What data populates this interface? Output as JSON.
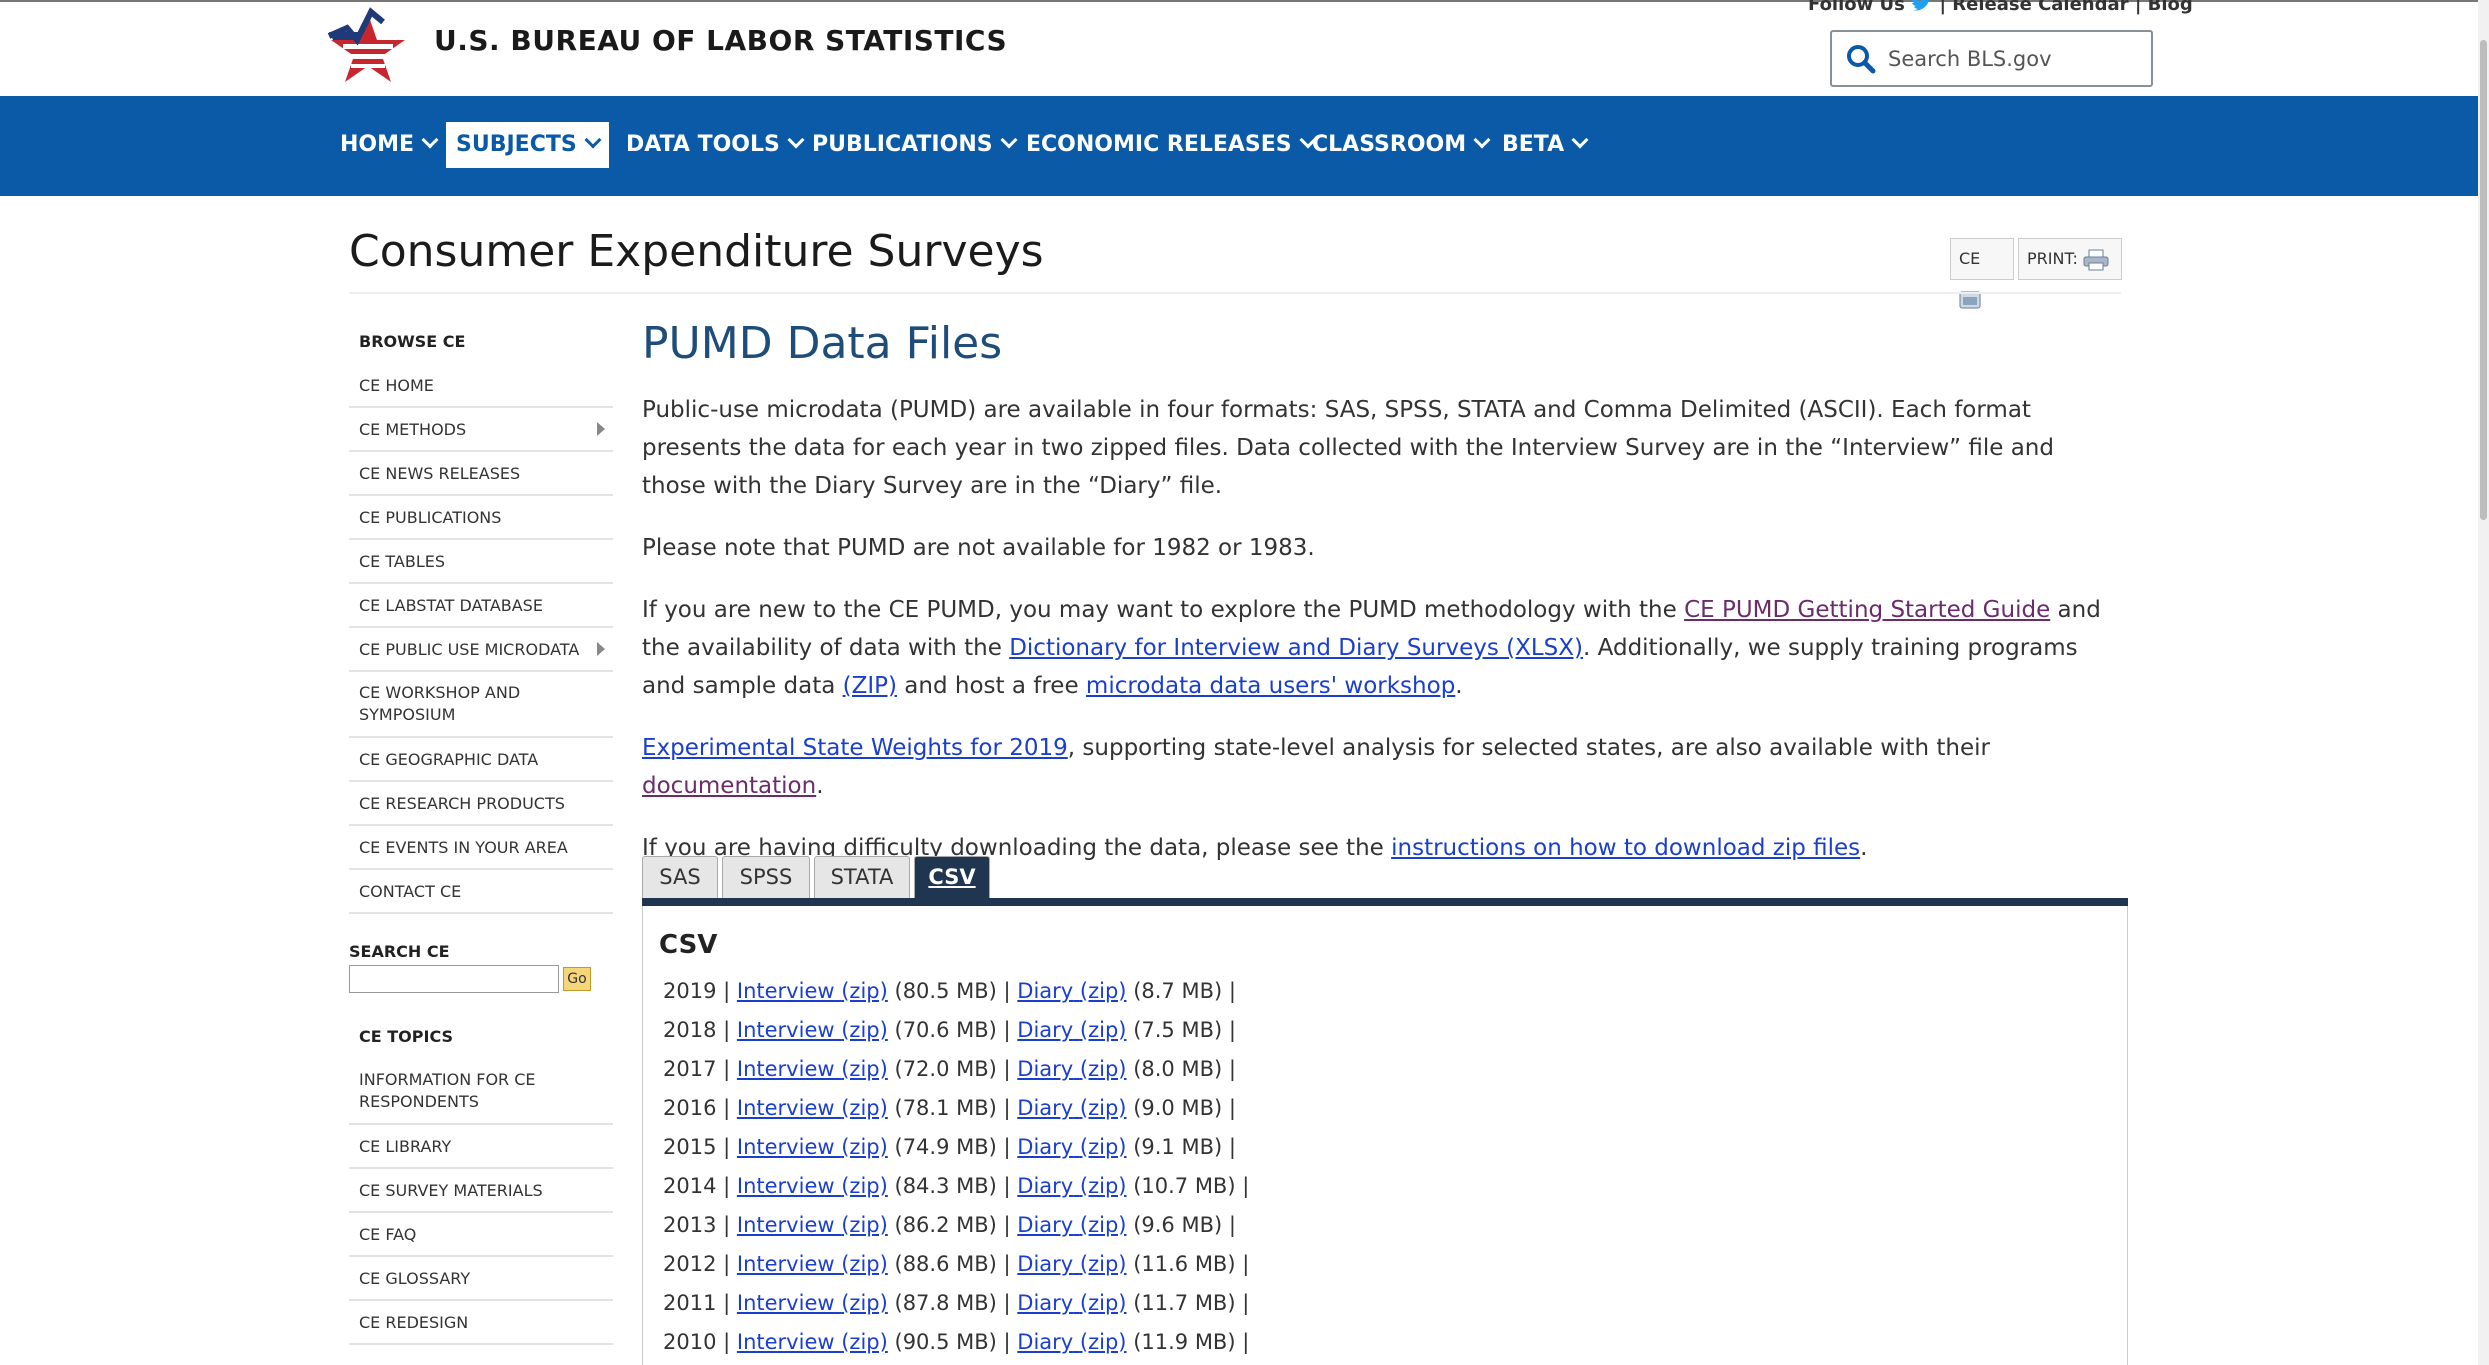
{
  "header": {
    "site_title": "U.S. BUREAU OF LABOR STATISTICS",
    "follow_us": "Follow Us",
    "release_calendar": "Release Calendar",
    "blog": "Blog",
    "search_placeholder": "Search BLS.gov"
  },
  "nav": {
    "items": [
      "HOME",
      "SUBJECTS",
      "DATA TOOLS",
      "PUBLICATIONS",
      "ECONOMIC RELEASES",
      "CLASSROOM",
      "BETA"
    ],
    "active": "SUBJECTS"
  },
  "page": {
    "title": "Consumer Expenditure Surveys",
    "tool_ce": "CE",
    "tool_print": "PRINT:"
  },
  "sidebar": {
    "browse_heading": "BROWSE CE",
    "browse_items": [
      "CE HOME",
      "CE METHODS",
      "CE NEWS RELEASES",
      "CE PUBLICATIONS",
      "CE TABLES",
      "CE LABSTAT DATABASE",
      "CE PUBLIC USE MICRODATA",
      "CE WORKSHOP AND SYMPOSIUM",
      "CE GEOGRAPHIC DATA",
      "CE RESEARCH PRODUCTS",
      "CE EVENTS IN YOUR AREA",
      "CONTACT CE"
    ],
    "search_label": "SEARCH CE",
    "go_label": "Go",
    "topics_heading": "CE TOPICS",
    "topics_items": [
      "INFORMATION FOR CE RESPONDENTS",
      "CE LIBRARY",
      "CE SURVEY MATERIALS",
      "CE FAQ",
      "CE GLOSSARY",
      "CE REDESIGN"
    ]
  },
  "main": {
    "heading": "PUMD Data Files",
    "p1": "Public-use microdata (PUMD) are available in four formats: SAS, SPSS, STATA and Comma Delimited (ASCII). Each format presents the data for each year in two zipped files. Data collected with the Interview Survey are in the “Interview” file and those with the Diary Survey are in the “Diary” file.",
    "p2": "Please note that PUMD are not available for 1982 or 1983.",
    "p3_a": "If you are new to the CE PUMD, you may want to explore the PUMD methodology with the ",
    "p3_link1": "CE PUMD Getting Started Guide",
    "p3_b": " and the availability of data with the ",
    "p3_link2": "Dictionary for Interview and Diary Surveys (XLSX)",
    "p3_c": ". Additionally, we supply training programs and sample data ",
    "p3_link3": "(ZIP)",
    "p3_d": " and host a free ",
    "p3_link4": "microdata data users' workshop",
    "p3_e": ".",
    "p4_link1": "Experimental State Weights for 2019",
    "p4_a": ", supporting state-level analysis for selected states, are also available with their ",
    "p4_link2": "documentation",
    "p4_b": ".",
    "p5_a": "If you are having difficulty downloading the data, please see the ",
    "p5_link": "instructions on how to download zip files",
    "p5_b": ".",
    "tabs": [
      "SAS",
      "SPSS",
      "STATA",
      "CSV"
    ],
    "active_tab": "CSV",
    "panel_title": "CSV",
    "interview_label": "Interview",
    "diary_label": "Diary",
    "zip_label": "(zip)",
    "rows": [
      {
        "year": "2019",
        "interview_size": "(80.5 MB)",
        "diary_size": "(8.7 MB)"
      },
      {
        "year": "2018",
        "interview_size": "(70.6 MB)",
        "diary_size": "(7.5 MB)"
      },
      {
        "year": "2017",
        "interview_size": "(72.0 MB)",
        "diary_size": "(8.0 MB)"
      },
      {
        "year": "2016",
        "interview_size": "(78.1 MB)",
        "diary_size": "(9.0 MB)"
      },
      {
        "year": "2015",
        "interview_size": "(74.9 MB)",
        "diary_size": "(9.1 MB)"
      },
      {
        "year": "2014",
        "interview_size": "(84.3 MB)",
        "diary_size": "(10.7 MB)"
      },
      {
        "year": "2013",
        "interview_size": "(86.2 MB)",
        "diary_size": "(9.6 MB)"
      },
      {
        "year": "2012",
        "interview_size": "(88.6 MB)",
        "diary_size": "(11.6 MB)"
      },
      {
        "year": "2011",
        "interview_size": "(87.8 MB)",
        "diary_size": "(11.7 MB)"
      },
      {
        "year": "2010",
        "interview_size": "(90.5 MB)",
        "diary_size": "(11.9 MB)"
      }
    ]
  },
  "colors": {
    "nav_bg": "#0a5aa8",
    "heading": "#1f4d7a",
    "link": "#1a3fcf",
    "visited_link": "#6b2c6b",
    "tab_active": "#1f3550"
  }
}
